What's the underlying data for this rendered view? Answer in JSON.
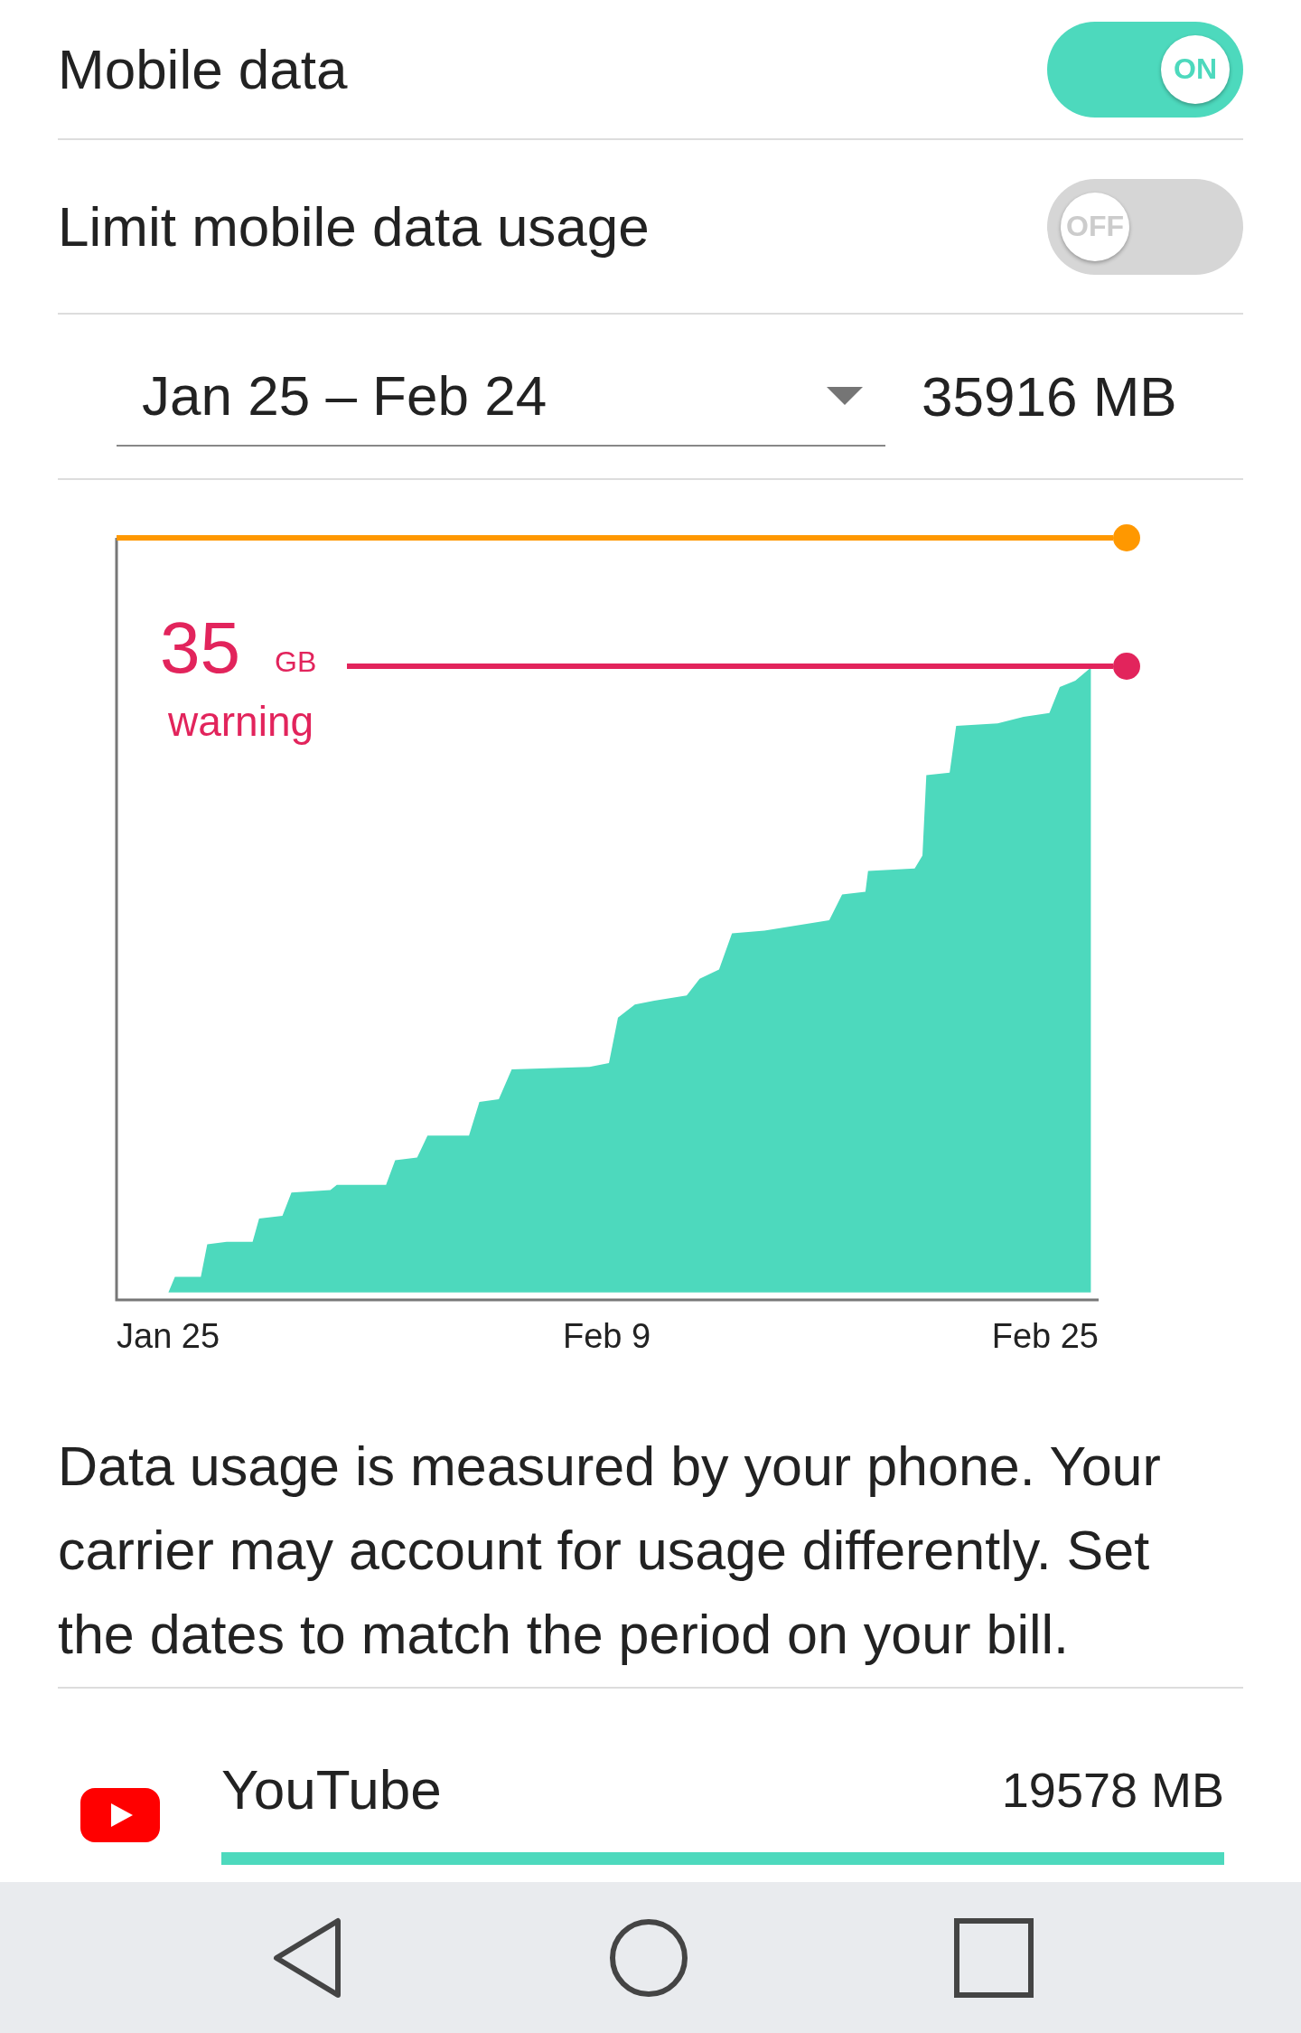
{
  "toggles": [
    {
      "label": "Mobile data",
      "on": true,
      "state_text": "ON"
    },
    {
      "label": "Limit mobile data usage",
      "on": false,
      "state_text": "OFF"
    }
  ],
  "cycle": {
    "value": "Jan 25 – Feb 24",
    "total": "35916 MB"
  },
  "chart": {
    "warning_value": "35",
    "warning_unit": "GB",
    "warning_label": "warning",
    "x_labels": [
      "Jan 25",
      "Feb 9",
      "Feb 25"
    ]
  },
  "note": "Data usage is measured by your phone. Your carrier may account for usage differently. Set the dates to match the period on your bill.",
  "apps": [
    {
      "name": "YouTube",
      "usage": "19578 MB"
    }
  ]
}
